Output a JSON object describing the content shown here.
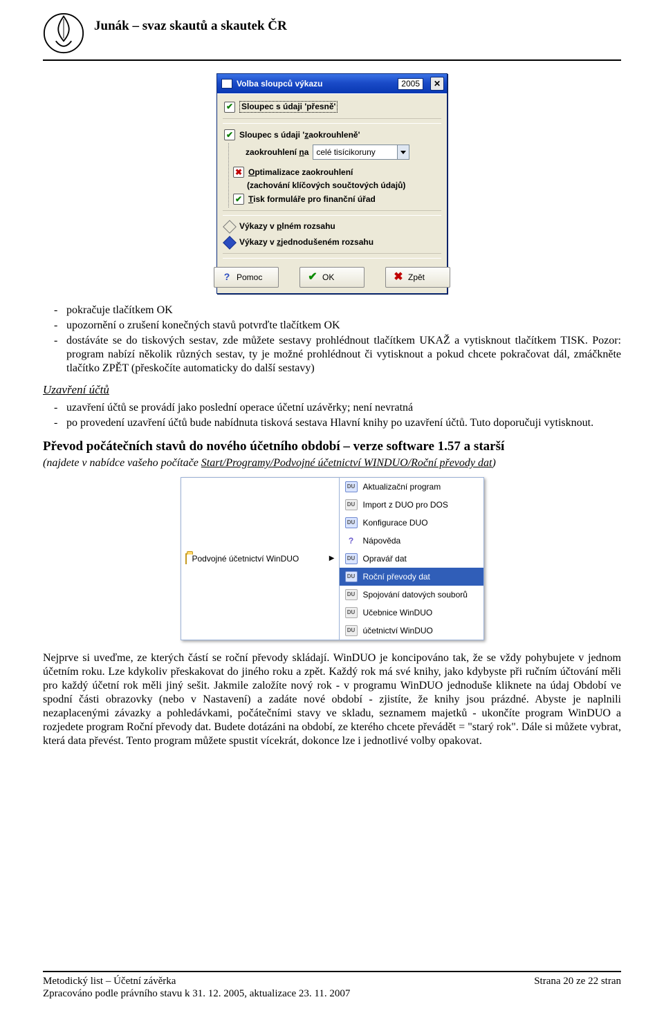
{
  "header": {
    "org": "Junák – svaz skautů a skautek ČR"
  },
  "dialog": {
    "title": "Volba sloupců výkazu",
    "year": "2005",
    "opt_presne": "Sloupec s údaji 'přesně'",
    "opt_zaokr": "Sloupec s údaji 'zaokrouhleně'",
    "round_label_pre": "zaokrouhlení ",
    "round_label_u": "n",
    "round_label_post": "a",
    "round_value": "celé tisícikoruny",
    "opt_optim": "Optimalizace zaokrouhlení",
    "opt_optim_sub": "(zachování klíčových součtových údajů)",
    "opt_tisk": "Tisk formuláře pro finanční úřad",
    "opt_plny": "Výkazy v plném rozsahu",
    "opt_zjed": "Výkazy v zjednodušeném rozsahu",
    "btn_help": "Pomoc",
    "btn_ok": "OK",
    "btn_back": "Zpět"
  },
  "bullets1": {
    "b1": "pokračuje tlačítkem OK",
    "b2": "upozornění o zrušení konečných stavů potvrďte tlačítkem OK",
    "b3": "dostáváte se do tiskových sestav, zde můžete sestavy prohlédnout tlačítkem UKAŽ a vytisknout tlačítkem TISK. Pozor: program nabízí několik různých sestav, ty je možné prohlédnout či vytisknout a pokud chcete pokračovat dál, zmáčkněte tlačítko ZPĚT (přeskočíte automaticky do další sestavy)"
  },
  "section_close": {
    "title": "Uzavření účtů"
  },
  "bullets2": {
    "b1": "uzavření účtů se provádí jako poslední operace účetní uzávěrky; není nevratná",
    "b2": "po provedení uzavření účtů bude nabídnuta tisková sestava Hlavní knihy po uzavření účtů. Tuto doporučuji vytisknout."
  },
  "transfer": {
    "heading": "Převod počátečních stavů do nového účetního období – verze software 1.57 a starší",
    "sub": "(najdete v nabídce vašeho počítače Start/Programy/Podvojné účetnictví WINDUO/Roční převody dat)"
  },
  "menu": {
    "parent": "Podvojné účetnictví WinDUO",
    "items": [
      "Aktualizační program",
      "Import z DUO pro DOS",
      "Konfigurace DUO",
      "Nápověda",
      "Opravář dat",
      "Roční převody dat",
      "Spojování datových souborů",
      "Učebnice WinDUO",
      "účetnictví WinDUO"
    ],
    "selected_index": 5
  },
  "para_bottom": "Nejprve si uveďme, ze kterých částí se roční převody skládají. WinDUO je koncipováno tak, že se vždy pohybujete v jednom účetním roku. Lze kdykoliv přeskakovat do jiného roku a zpět. Každý rok má své knihy, jako kdybyste při ručním účtování měli pro každý účetní rok měli jiný sešit. Jakmile založíte nový rok - v programu WinDUO jednoduše kliknete na údaj Období ve spodní části obrazovky (nebo v Nastavení) a zadáte nové období - zjistíte, že knihy jsou prázdné. Abyste je naplnili nezaplacenými závazky a pohledávkami, počátečními stavy ve skladu, seznamem majetků - ukončíte program WinDUO a rozjedete program Roční převody dat. Budete dotázáni na období, ze kterého chcete převádět = \"starý rok\". Dále si můžete vybrat, která data převést. Tento program můžete spustit vícekrát, dokonce lze i jednotlivé volby opakovat.",
  "footer": {
    "left1": "Metodický list – Účetní závěrka",
    "left2": "Zpracováno podle právního stavu k 31. 12. 2005, aktualizace 23. 11. 2007 ",
    "right": "Strana 20 ze 22 stran"
  }
}
